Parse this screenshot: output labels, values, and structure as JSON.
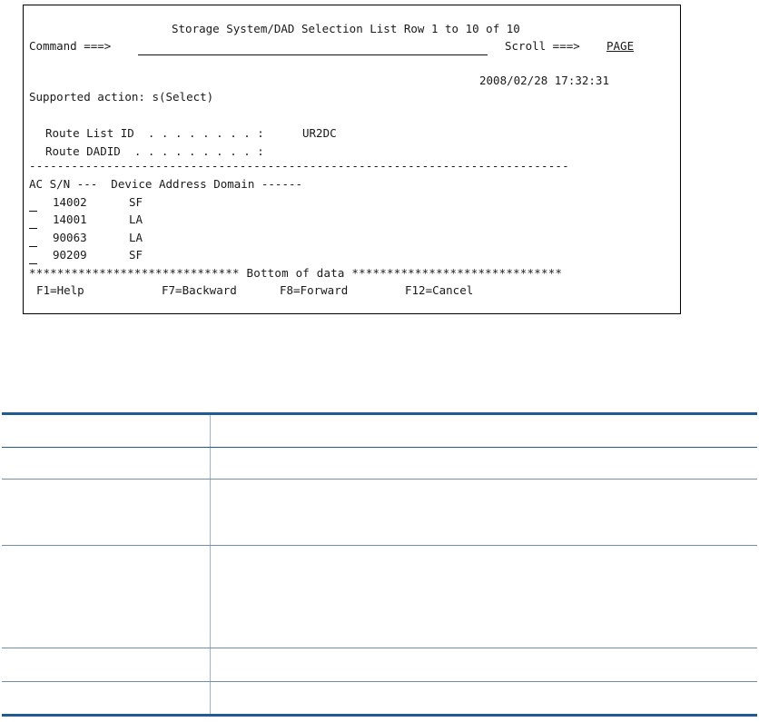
{
  "screen": {
    "title": "Storage System/DAD Selection List Row 1 to 10 of 10",
    "command_label": "Command ===>",
    "command_value": "",
    "scroll_label": "Scroll ===>",
    "scroll_value": "PAGE",
    "timestamp": "2008/02/28 17:32:31",
    "supported_action": "Supported action: s(Select)",
    "route_list_id_label": "Route List ID  . . . . . . . . :",
    "route_list_id_value": "UR2DC",
    "route_dadid_label": "Route DADID  . . . . . . . . . :",
    "route_dadid_value": "",
    "separator": "-----------------------------------------------------------------------------",
    "column_header": "AC S/N ---  Device Address Domain ------",
    "rows": [
      {
        "ac": "",
        "sn": "14002",
        "domain": "SF"
      },
      {
        "ac": "",
        "sn": "14001",
        "domain": "LA"
      },
      {
        "ac": "",
        "sn": "90063",
        "domain": "LA"
      },
      {
        "ac": "",
        "sn": "90209",
        "domain": "SF"
      }
    ],
    "bottom_banner": "****************************** Bottom of data ******************************",
    "function_keys": {
      "help": "F1=Help",
      "backward": "F7=Backward",
      "forward": "F8=Forward",
      "cancel": "F12=Cancel"
    }
  },
  "description_table": {
    "headers": [
      "",
      ""
    ],
    "rows": [
      [
        "",
        ""
      ],
      [
        "",
        ""
      ],
      [
        "",
        ""
      ],
      [
        "",
        ""
      ],
      [
        "",
        ""
      ]
    ]
  }
}
